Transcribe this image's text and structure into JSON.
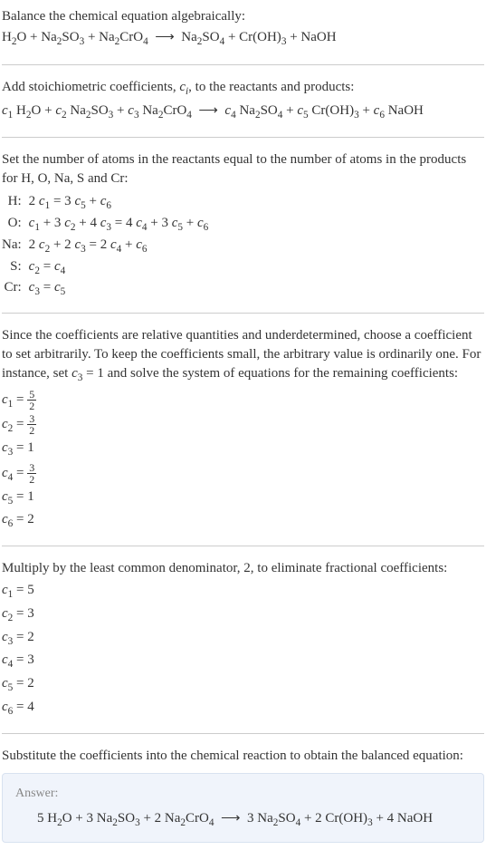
{
  "intro": {
    "line1": "Balance the chemical equation algebraically:",
    "equation_html": "H<sub>2</sub>O + Na<sub>2</sub>SO<sub>3</sub> + Na<sub>2</sub>CrO<sub>4</sub> &nbsp;⟶&nbsp; Na<sub>2</sub>SO<sub>4</sub> + Cr(OH)<sub>3</sub> + NaOH"
  },
  "step_coeffs": {
    "text_html": "Add stoichiometric coefficients, <span class=\"italic\">c<sub>i</sub></span>, to the reactants and products:",
    "equation_html": "<span class=\"italic\">c</span><sub>1</sub> H<sub>2</sub>O + <span class=\"italic\">c</span><sub>2</sub> Na<sub>2</sub>SO<sub>3</sub> + <span class=\"italic\">c</span><sub>3</sub> Na<sub>2</sub>CrO<sub>4</sub> &nbsp;⟶&nbsp; <span class=\"italic\">c</span><sub>4</sub> Na<sub>2</sub>SO<sub>4</sub> + <span class=\"italic\">c</span><sub>5</sub> Cr(OH)<sub>3</sub> + <span class=\"italic\">c</span><sub>6</sub> NaOH"
  },
  "atoms": {
    "text": "Set the number of atoms in the reactants equal to the number of atoms in the products for H, O, Na, S and Cr:",
    "rows": [
      {
        "label": "H:",
        "eq_html": "2 <span class=\"italic\">c</span><sub>1</sub> = 3 <span class=\"italic\">c</span><sub>5</sub> + <span class=\"italic\">c</span><sub>6</sub>"
      },
      {
        "label": "O:",
        "eq_html": "<span class=\"italic\">c</span><sub>1</sub> + 3 <span class=\"italic\">c</span><sub>2</sub> + 4 <span class=\"italic\">c</span><sub>3</sub> = 4 <span class=\"italic\">c</span><sub>4</sub> + 3 <span class=\"italic\">c</span><sub>5</sub> + <span class=\"italic\">c</span><sub>6</sub>"
      },
      {
        "label": "Na:",
        "eq_html": "2 <span class=\"italic\">c</span><sub>2</sub> + 2 <span class=\"italic\">c</span><sub>3</sub> = 2 <span class=\"italic\">c</span><sub>4</sub> + <span class=\"italic\">c</span><sub>6</sub>"
      },
      {
        "label": "S:",
        "eq_html": "<span class=\"italic\">c</span><sub>2</sub> = <span class=\"italic\">c</span><sub>4</sub>"
      },
      {
        "label": "Cr:",
        "eq_html": "<span class=\"italic\">c</span><sub>3</sub> = <span class=\"italic\">c</span><sub>5</sub>"
      }
    ]
  },
  "solve": {
    "text_html": "Since the coefficients are relative quantities and underdetermined, choose a coefficient to set arbitrarily. To keep the coefficients small, the arbitrary value is ordinarily one. For instance, set <span class=\"italic\">c</span><sub>3</sub> = 1 and solve the system of equations for the remaining coefficients:",
    "coeffs": [
      {
        "html": "<span class=\"italic\">c</span><sub>1</sub> = <span class=\"frac\"><span class=\"num\">5</span><span class=\"den\">2</span></span>"
      },
      {
        "html": "<span class=\"italic\">c</span><sub>2</sub> = <span class=\"frac\"><span class=\"num\">3</span><span class=\"den\">2</span></span>"
      },
      {
        "html": "<span class=\"italic\">c</span><sub>3</sub> = 1"
      },
      {
        "html": "<span class=\"italic\">c</span><sub>4</sub> = <span class=\"frac\"><span class=\"num\">3</span><span class=\"den\">2</span></span>"
      },
      {
        "html": "<span class=\"italic\">c</span><sub>5</sub> = 1"
      },
      {
        "html": "<span class=\"italic\">c</span><sub>6</sub> = 2"
      }
    ]
  },
  "multiply": {
    "text": "Multiply by the least common denominator, 2, to eliminate fractional coefficients:",
    "coeffs": [
      {
        "html": "<span class=\"italic\">c</span><sub>1</sub> = 5"
      },
      {
        "html": "<span class=\"italic\">c</span><sub>2</sub> = 3"
      },
      {
        "html": "<span class=\"italic\">c</span><sub>3</sub> = 2"
      },
      {
        "html": "<span class=\"italic\">c</span><sub>4</sub> = 3"
      },
      {
        "html": "<span class=\"italic\">c</span><sub>5</sub> = 2"
      },
      {
        "html": "<span class=\"italic\">c</span><sub>6</sub> = 4"
      }
    ]
  },
  "final": {
    "text": "Substitute the coefficients into the chemical reaction to obtain the balanced equation:",
    "answer_label": "Answer:",
    "answer_html": "5 H<sub>2</sub>O + 3 Na<sub>2</sub>SO<sub>3</sub> + 2 Na<sub>2</sub>CrO<sub>4</sub> &nbsp;⟶&nbsp; 3 Na<sub>2</sub>SO<sub>4</sub> + 2 Cr(OH)<sub>3</sub> + 4 NaOH"
  },
  "chart_data": {
    "type": "table",
    "title": "Balanced chemical equation coefficients",
    "reactants": [
      {
        "species": "H2O",
        "coefficient": 5
      },
      {
        "species": "Na2SO3",
        "coefficient": 3
      },
      {
        "species": "Na2CrO4",
        "coefficient": 2
      }
    ],
    "products": [
      {
        "species": "Na2SO4",
        "coefficient": 3
      },
      {
        "species": "Cr(OH)3",
        "coefficient": 2
      },
      {
        "species": "NaOH",
        "coefficient": 4
      }
    ],
    "atom_balance": [
      {
        "element": "H",
        "lhs": "2 c1",
        "rhs": "3 c5 + c6"
      },
      {
        "element": "O",
        "lhs": "c1 + 3 c2 + 4 c3",
        "rhs": "4 c4 + 3 c5 + c6"
      },
      {
        "element": "Na",
        "lhs": "2 c2 + 2 c3",
        "rhs": "2 c4 + c6"
      },
      {
        "element": "S",
        "lhs": "c2",
        "rhs": "c4"
      },
      {
        "element": "Cr",
        "lhs": "c3",
        "rhs": "c5"
      }
    ],
    "fractional_solution": {
      "c1": "5/2",
      "c2": "3/2",
      "c3": 1,
      "c4": "3/2",
      "c5": 1,
      "c6": 2
    },
    "integer_solution": {
      "c1": 5,
      "c2": 3,
      "c3": 2,
      "c4": 3,
      "c5": 2,
      "c6": 4
    }
  }
}
